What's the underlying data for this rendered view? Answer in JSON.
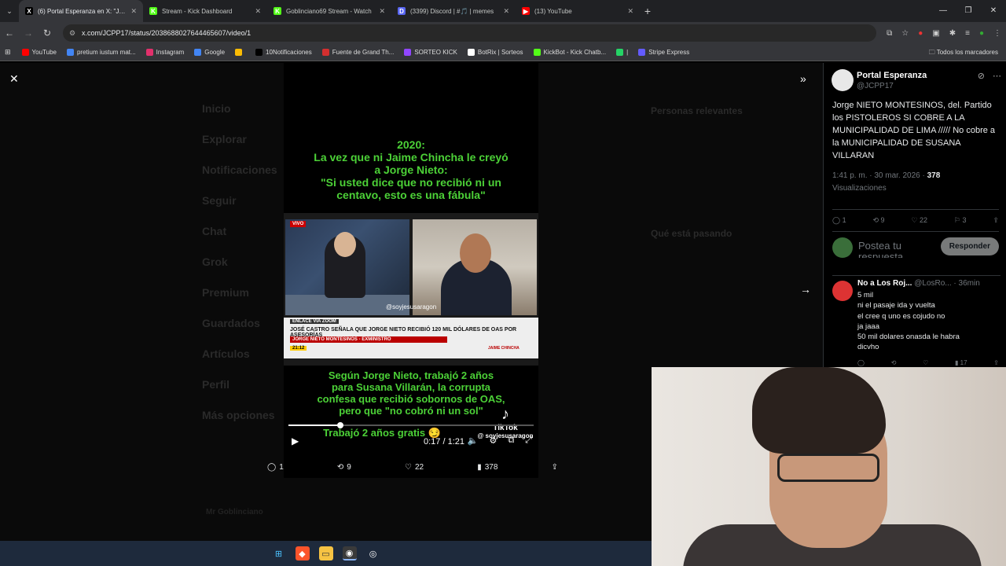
{
  "tabs": [
    {
      "title": "(6) Portal Esperanza en X: \"Jorge",
      "icon": "X",
      "color": "#000000",
      "active": true
    },
    {
      "title": "Stream - Kick Dashboard",
      "icon": "K",
      "color": "#53fc18"
    },
    {
      "title": "Goblinciano69 Stream - Watch",
      "icon": "K",
      "color": "#53fc18"
    },
    {
      "title": "(3399) Discord | #🎵 | memes",
      "icon": "D",
      "color": "#5865f2"
    },
    {
      "title": "(13) YouTube",
      "icon": "▶",
      "color": "#ff0000"
    }
  ],
  "url": "x.com/JCPP17/status/2038688027644465607/video/1",
  "bookmarks": [
    {
      "label": "YouTube",
      "color": "#ff0000"
    },
    {
      "label": "pretium iustum mat...",
      "color": "#4285f4"
    },
    {
      "label": "Instagram",
      "color": "#e1306c"
    },
    {
      "label": "Google",
      "color": "#4285f4"
    },
    {
      "label": "",
      "color": "#fbbc04"
    },
    {
      "label": "10Notificaciones",
      "color": "#000000"
    },
    {
      "label": "Fuente de Grand Th...",
      "color": "#d32f2f"
    },
    {
      "label": "SORTEO KICK",
      "color": "#9146ff"
    },
    {
      "label": "BotRix | Sorteos",
      "color": "#ffffff"
    },
    {
      "label": "KickBot - Kick Chatb...",
      "color": "#53fc18"
    },
    {
      "label": "|",
      "color": "#25d366"
    },
    {
      "label": "Stripe Express",
      "color": "#635bff"
    }
  ],
  "bookmarks_all": "Todos los marcadores",
  "video": {
    "caption_top": "2020:\nLa vez que ni Jaime Chincha le creyó\na Jorge Nieto:\n\"Si usted dice que no recibió ni un\ncentavo, esto es una fábula\"",
    "live_tag": "VIVO",
    "handle_overlay": "@soyjesusaragon",
    "lt_a": "ENLACE VÍA ZOOM",
    "lt_b": "JOSÉ CASTRO SEÑALA QUE JORGE NIETO RECIBIÓ 120 MIL DÓLARES DE OAS POR ASESORÍAS",
    "lt_c": "JORGE NIETO MONTESINOS - EXMINISTRO",
    "lt_time": "21:12",
    "lt_name": "JAIME CHINCHA",
    "caption_bottom": "Según Jorge Nieto, trabajó 2 años\npara Susana Villarán, la corrupta\nconfesa que recibió sobornos de OAS,\npero que \"no cobró ni un sol\"",
    "caption_bottom2": "Trabajó 2 años gratis 😏",
    "tiktok": "TikTok",
    "tiktok_handle": "@ soyjesusaragon",
    "time": "0:17 / 1:21",
    "progress": 0.21
  },
  "stats": {
    "replies": "1",
    "reposts": "9",
    "likes": "22",
    "views": "378"
  },
  "post": {
    "name": "Portal Esperanza",
    "handle": "@JCPP17",
    "text": "Jorge NIETO MONTESINOS, del. Partido los PISTOLEROS SI COBRE A LA MUNICIPALIDAD DE LIMA ///// No cobre a la MUNICIPALIDAD DE SUSANA VILLARAN",
    "time": "1:41 p. m. · 30 mar. 2026 · ",
    "views_count": "378",
    "views_label": "Visualizaciones",
    "replies": "1",
    "reposts": "9",
    "likes": "22",
    "bookmarks": "3"
  },
  "reply": {
    "placeholder": "Postea tu respuesta",
    "button": "Responder"
  },
  "comment": {
    "name": "No a Los Roj...",
    "handle": "@LosRo... · 36min",
    "text": "5 mil\n ni el pasaje ida  y vuelta\n el cree q uno es cojudo no\n ja jaaa\n 50 mil dolares onasda le habra\n dicvho",
    "views": "17"
  },
  "ghost_nav": [
    "Inicio",
    "Explorar",
    "Notificaciones",
    "Seguir",
    "Chat",
    "Grok",
    "Premium",
    "Guardados",
    "Artículos",
    "Perfil",
    "Más opciones"
  ],
  "ghost_right": [
    "Personas relevantes",
    "Qué está pasando"
  ],
  "ghost_user": "Mr Goblinciano"
}
